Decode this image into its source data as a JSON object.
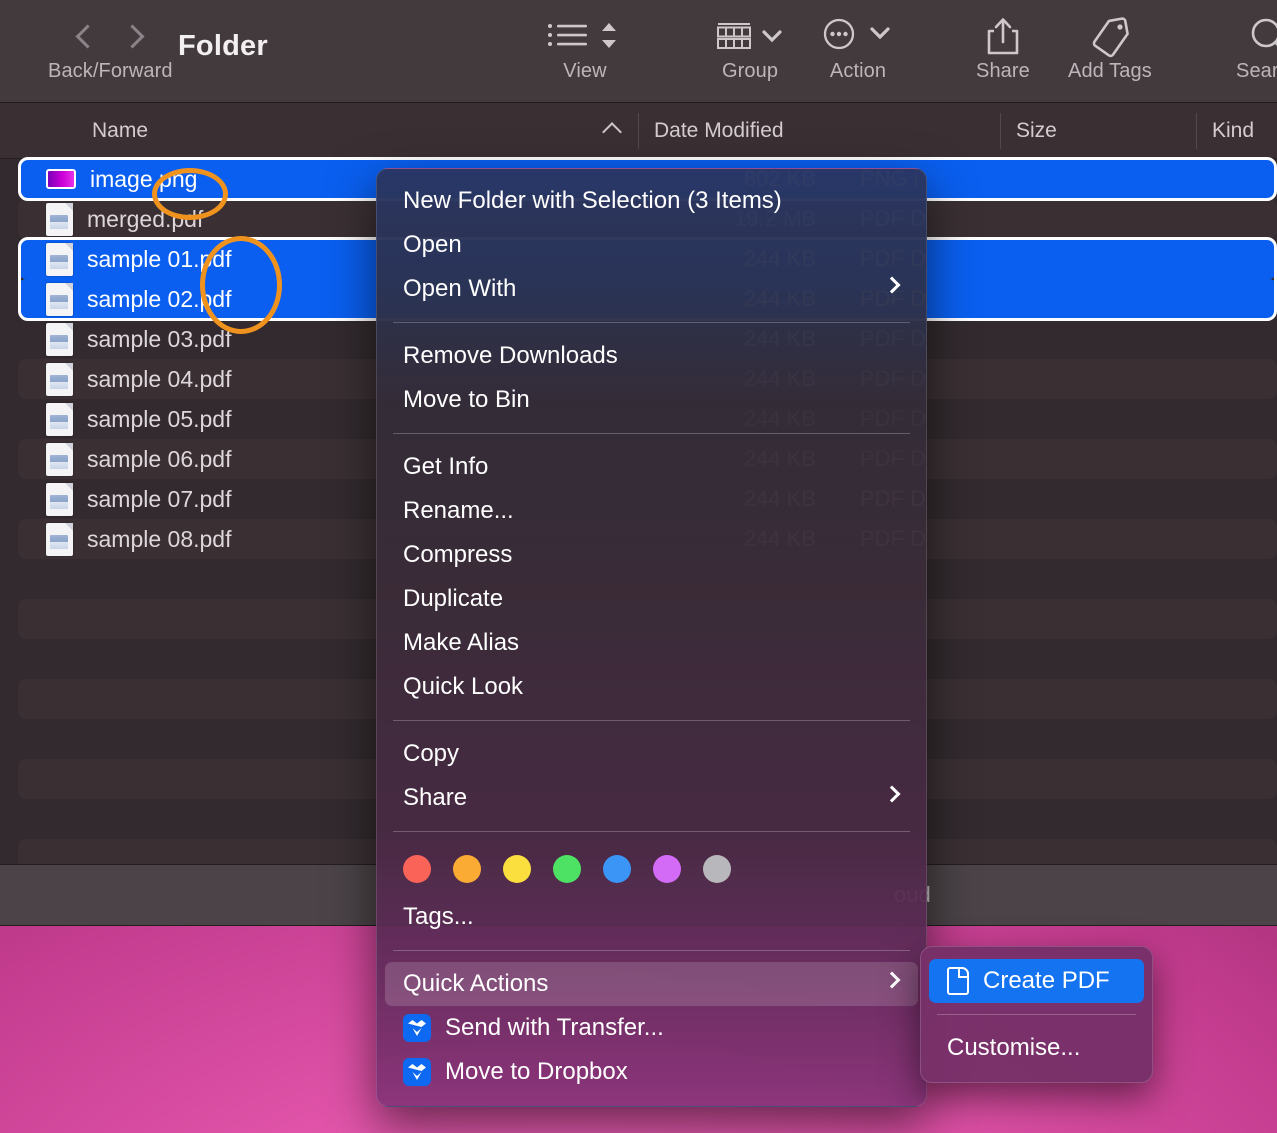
{
  "window": {
    "title": "Folder",
    "toolbar": [
      {
        "label": "Back/Forward",
        "icon": "back-forward-chevrons"
      },
      {
        "label": "View",
        "icon": "list-view-icon"
      },
      {
        "label": "Group",
        "icon": "group-grid-icon"
      },
      {
        "label": "Action",
        "icon": "ellipsis-circle-icon"
      },
      {
        "label": "Share",
        "icon": "share-upload-icon"
      },
      {
        "label": "Add Tags",
        "icon": "tag-icon"
      },
      {
        "label": "Search",
        "icon": "search-icon"
      }
    ]
  },
  "columns": {
    "name": "Name",
    "date_modified": "Date Modified",
    "size": "Size",
    "kind": "Kind",
    "sort_indicator": "ascending"
  },
  "files": [
    {
      "name": "image.png",
      "size": "802 KB",
      "kind": "PNG i",
      "icon": "png-thumbnail-icon",
      "selected": true,
      "stripe": false
    },
    {
      "name": "merged.pdf",
      "size": "19.2 MB",
      "kind": "PDF D",
      "icon": "pdf-document-icon",
      "selected": false,
      "stripe": true
    },
    {
      "name": "sample 01.pdf",
      "size": "244 KB",
      "kind": "PDF D",
      "icon": "pdf-document-icon",
      "selected": true,
      "stripe": false
    },
    {
      "name": "sample 02.pdf",
      "size": "244 KB",
      "kind": "PDF D",
      "icon": "pdf-document-icon",
      "selected": true,
      "stripe": true
    },
    {
      "name": "sample 03.pdf",
      "size": "244 KB",
      "kind": "PDF D",
      "icon": "pdf-document-icon",
      "selected": false,
      "stripe": false
    },
    {
      "name": "sample 04.pdf",
      "size": "244 KB",
      "kind": "PDF D",
      "icon": "pdf-document-icon",
      "selected": false,
      "stripe": true
    },
    {
      "name": "sample 05.pdf",
      "size": "244 KB",
      "kind": "PDF D",
      "icon": "pdf-document-icon",
      "selected": false,
      "stripe": false
    },
    {
      "name": "sample 06.pdf",
      "size": "244 KB",
      "kind": "PDF D",
      "icon": "pdf-document-icon",
      "selected": false,
      "stripe": true
    },
    {
      "name": "sample 07.pdf",
      "size": "244 KB",
      "kind": "PDF D",
      "icon": "pdf-document-icon",
      "selected": false,
      "stripe": false
    },
    {
      "name": "sample 08.pdf",
      "size": "244 KB",
      "kind": "PDF D",
      "icon": "pdf-document-icon",
      "selected": false,
      "stripe": true
    }
  ],
  "status_bar": {
    "text": "oud"
  },
  "context_menu": {
    "items": [
      {
        "label": "New Folder with Selection (3 Items)",
        "submenu": false
      },
      {
        "label": "Open",
        "submenu": false
      },
      {
        "label": "Open With",
        "submenu": true
      },
      {
        "label": "Remove Downloads",
        "submenu": false
      },
      {
        "label": "Move to Bin",
        "submenu": false
      },
      {
        "label": "Get Info",
        "submenu": false
      },
      {
        "label": "Rename...",
        "submenu": false
      },
      {
        "label": "Compress",
        "submenu": false
      },
      {
        "label": "Duplicate",
        "submenu": false
      },
      {
        "label": "Make Alias",
        "submenu": false
      },
      {
        "label": "Quick Look",
        "submenu": false
      },
      {
        "label": "Copy",
        "submenu": false
      },
      {
        "label": "Share",
        "submenu": true
      },
      {
        "label": "Tags...",
        "submenu": false
      },
      {
        "label": "Quick Actions",
        "submenu": true,
        "highlighted": true
      },
      {
        "label": "Send with Transfer...",
        "submenu": false,
        "icon": "dropbox-icon"
      },
      {
        "label": "Move to Dropbox",
        "submenu": false,
        "icon": "dropbox-icon"
      }
    ],
    "tag_colors": [
      "#fa6357",
      "#f9ab34",
      "#fbdf3e",
      "#4ee264",
      "#3b95f6",
      "#d36bf7",
      "#b8b8bc"
    ]
  },
  "submenu": {
    "items": [
      {
        "label": "Create PDF",
        "icon": "page-icon",
        "selected": true
      },
      {
        "label": "Customise...",
        "icon": null,
        "selected": false
      }
    ]
  },
  "annotations": {
    "color": "#f0931e",
    "count": 2
  }
}
